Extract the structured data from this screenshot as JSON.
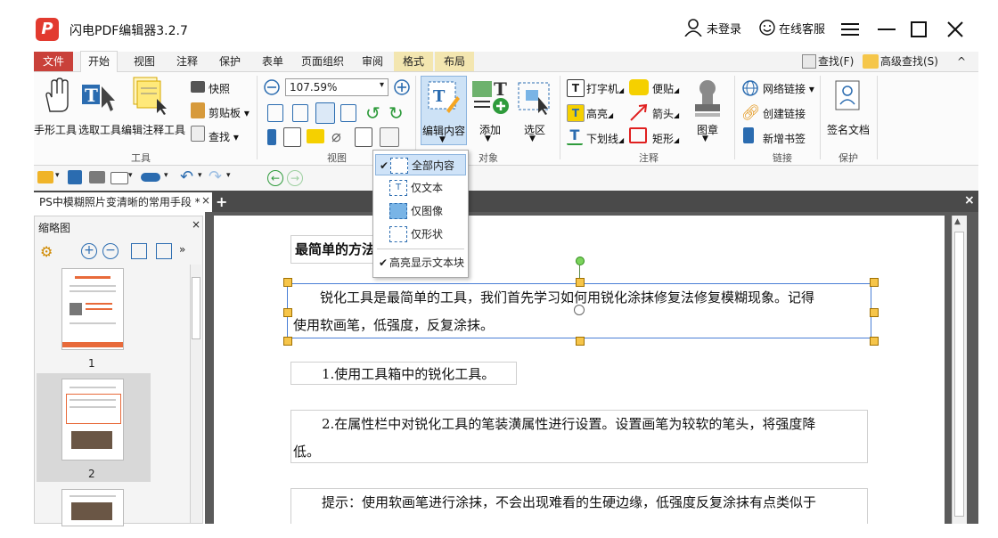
{
  "app": {
    "title": "闪电PDF编辑器3.2.7",
    "logo_letter": "P"
  },
  "titlebar": {
    "login": "未登录",
    "support": "在线客服"
  },
  "tabs": [
    {
      "label": "文件",
      "active": false,
      "file": true
    },
    {
      "label": "开始",
      "active": true
    },
    {
      "label": "视图"
    },
    {
      "label": "注释"
    },
    {
      "label": "保护"
    },
    {
      "label": "表单"
    },
    {
      "label": "页面组织"
    },
    {
      "label": "审阅"
    },
    {
      "label": "格式",
      "context": true
    },
    {
      "label": "布局",
      "context": true
    }
  ],
  "search": {
    "find": "查找(F)",
    "advanced": "高级查找(S)"
  },
  "ribbon": {
    "tools": {
      "hand": "手形工具",
      "select": "选取工具",
      "edit_annot": "编辑注释工具",
      "snapshot": "快照",
      "clipboard": "剪贴板",
      "find": "查找",
      "group": "工具"
    },
    "view": {
      "zoom": "107.59%",
      "group": "视图"
    },
    "object": {
      "edit_content": "编辑内容",
      "add": "添加",
      "select_area": "选区",
      "group": "对象"
    },
    "annot": {
      "typewriter": "打字机",
      "sticky": "便贴",
      "highlight": "高亮",
      "arrow": "箭头",
      "underline": "下划线",
      "rect": "矩形",
      "stamp": "图章",
      "group": "注释"
    },
    "link": {
      "web_link": "网络链接",
      "create_link": "创建链接",
      "new_bookmark": "新增书签",
      "group": "链接"
    },
    "protect": {
      "sign": "签名文档",
      "group": "保护"
    }
  },
  "doc_tab": {
    "title": "PS中模糊照片变清晰的常用手段 *"
  },
  "thumbs": {
    "title": "缩略图",
    "pages": [
      "1",
      "2"
    ]
  },
  "dropdown": {
    "items": [
      {
        "label": "全部内容",
        "checked": true
      },
      {
        "label": "仅文本",
        "checked": false
      },
      {
        "label": "仅图像",
        "checked": false
      },
      {
        "label": "仅形状",
        "checked": false
      }
    ],
    "highlight_blocks": "高亮显示文本块"
  },
  "document": {
    "heading": "最简单的方法",
    "para1_line1": "锐化工具是最简单的工具，我们首先学习如何用锐化涂抹修复法修复模糊现象。记得",
    "para1_line2": "使用软画笔，低强度，反复涂抹。",
    "step1": "1.使用工具箱中的锐化工具。",
    "step2_line1": "2.在属性栏中对锐化工具的笔装潢属性进行设置。设置画笔为较软的笔头，将强度降",
    "step2_line2": "低。",
    "tip": "提示：使用软画笔进行涂抹，不会出现难看的生硬边缘，低强度反复涂抹有点类似于"
  }
}
